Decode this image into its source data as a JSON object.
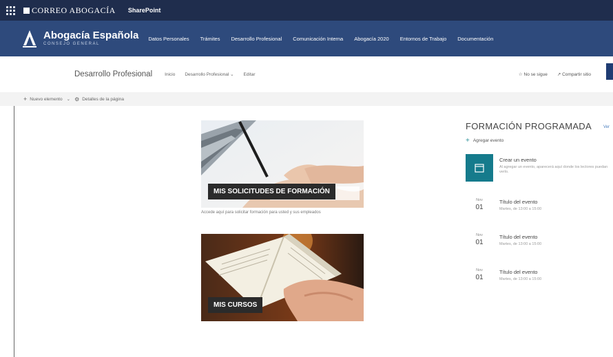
{
  "suite_bar": {
    "brand": "CORREO ABOGACÍA",
    "product": "SharePoint"
  },
  "site_header": {
    "title": "Abogacía Española",
    "subtitle": "CONSEJO GENERAL",
    "nav": [
      "Datos Personales",
      "Trámites",
      "Desarrollo Profesional",
      "Comunicación Interna",
      "Abogacía 2020",
      "Entornos de Trabajo",
      "Documentación"
    ]
  },
  "page_header": {
    "site_name": "Desarrollo Profesional",
    "local_nav": {
      "home": "Inicio",
      "current": "Desarrollo Profesional",
      "edit": "Editar"
    },
    "following": "No se sigue",
    "share": "Compartir sitio"
  },
  "command_bar": {
    "new_item": "Nuevo elemento",
    "page_details": "Detalles de la página"
  },
  "tiles": [
    {
      "label": "MIS SOLICITUDES DE FORMACIÓN",
      "caption": "Accede aquí para solicitar formación para usted y sus empleados"
    },
    {
      "label": "MIS CURSOS"
    }
  ],
  "events": {
    "title": "FORMACIÓN PROGRAMADA",
    "see_all": "Ver",
    "add_event": "Agregar evento",
    "create": {
      "title": "Crear un evento",
      "description": "Al agregar un evento, aparecerá aquí donde los lectores puedan verlo."
    },
    "items": [
      {
        "month": "Nov",
        "day": "01",
        "title": "Título del evento",
        "time": "Martes, de 13:00 a 15:00"
      },
      {
        "month": "Nov",
        "day": "01",
        "title": "Título del evento",
        "time": "Martes, de 13:00 a 15:00"
      },
      {
        "month": "Nov",
        "day": "01",
        "title": "Título del evento",
        "time": "Martes, de 13:00 a 15:00"
      }
    ]
  },
  "colors": {
    "suite_bar": "#1f2d4d",
    "site_header": "#2e4a7c",
    "accent": "#157b8c"
  }
}
